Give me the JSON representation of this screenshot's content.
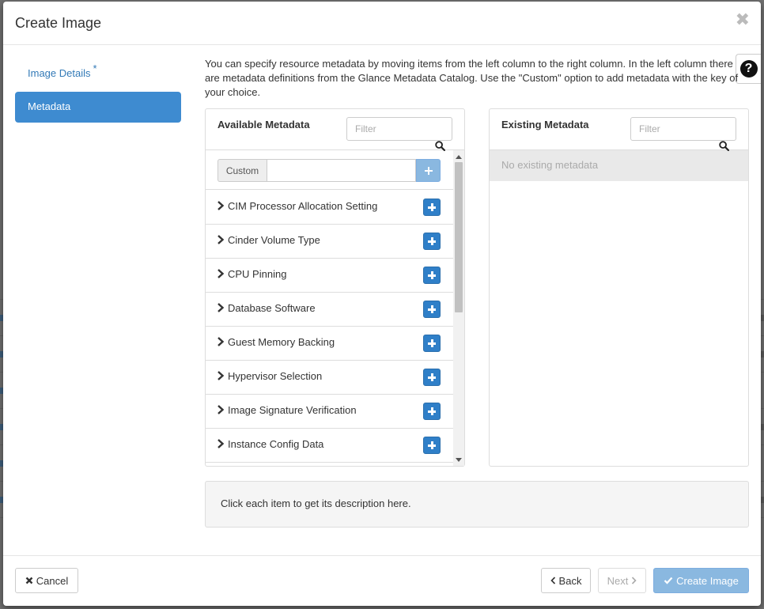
{
  "dialog": {
    "title": "Create Image",
    "close_glyph": "✖"
  },
  "nav": {
    "items": [
      {
        "label": "Image Details",
        "required_mark": "*",
        "active": false
      },
      {
        "label": "Metadata",
        "active": true
      }
    ]
  },
  "description": "You can specify resource metadata by moving items from the left column to the right column. In the left column there are metadata definitions from the Glance Metadata Catalog. Use the \"Custom\" option to add metadata with the key of your choice.",
  "available": {
    "title": "Available Metadata",
    "filter_placeholder": "Filter",
    "custom_label": "Custom",
    "custom_value": "",
    "items": [
      "CIM Processor Allocation Setting",
      "Cinder Volume Type",
      "CPU Pinning",
      "Database Software",
      "Guest Memory Backing",
      "Hypervisor Selection",
      "Image Signature Verification",
      "Instance Config Data"
    ]
  },
  "existing": {
    "title": "Existing Metadata",
    "filter_placeholder": "Filter",
    "empty_text": "No existing metadata"
  },
  "info_text": "Click each item to get its description here.",
  "footer": {
    "cancel_label": "Cancel",
    "back_label": "Back",
    "next_label": "Next",
    "create_label": "Create Image"
  },
  "colors": {
    "primary": "#3e8bd0",
    "add_button": "#2f7fc8",
    "disabled_primary": "#8ab8e0"
  }
}
